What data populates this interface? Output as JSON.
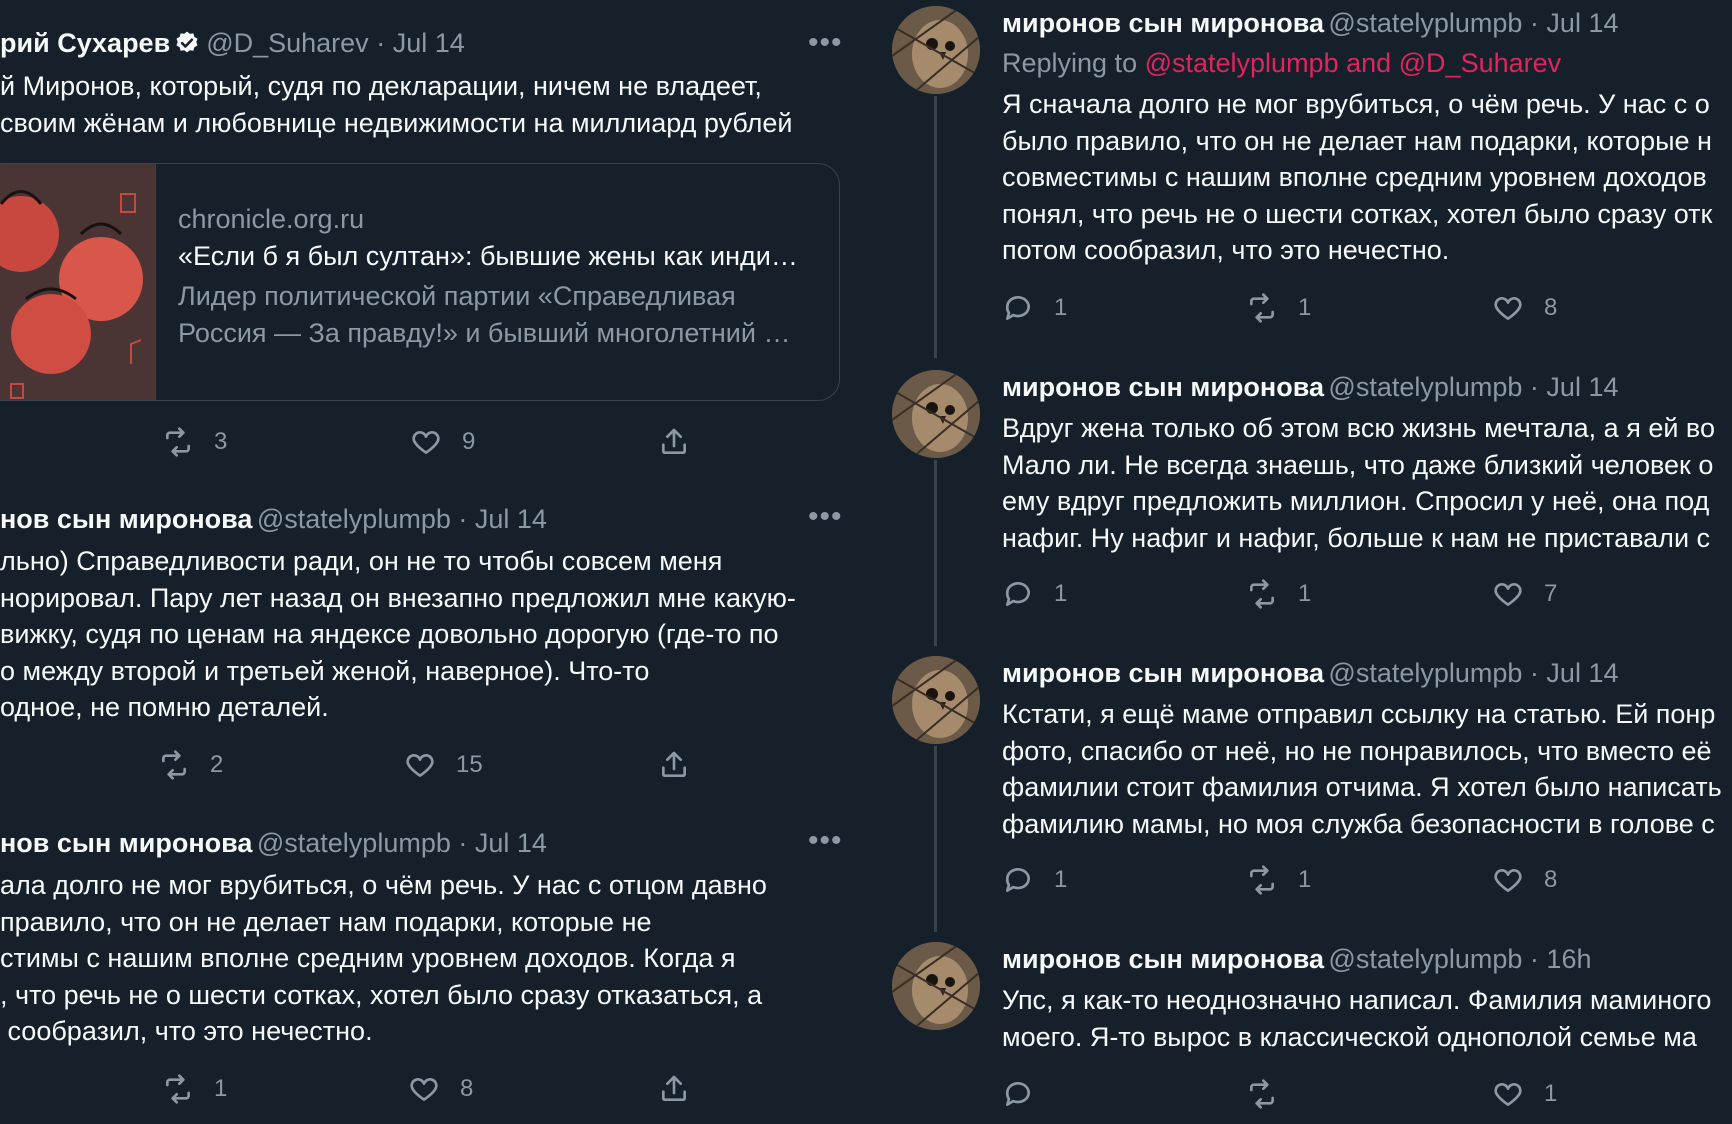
{
  "left_panel": {
    "tweets": [
      {
        "name": "рий Сухарев",
        "handle": "@D_Suharev",
        "date": "Jul 14",
        "text_lines": [
          "й Миронов, который, судя по декларации, ничем не владеет,",
          "своим жёнам и любовнице недвижимости на миллиард рублей"
        ],
        "card": {
          "domain": "chronicle.org.ru",
          "title": "«Если б я был султан»: бывшие жены как инди…",
          "desc_lines": [
            "Лидер политической партии «Справедливая",
            "Россия — За правду!» и бывший многолетний …"
          ]
        },
        "retweets": "3",
        "likes": "9"
      },
      {
        "name": "нов сын миронова",
        "handle": "@statelyplumpb",
        "date": "Jul 14",
        "text_lines": [
          "льно) Справедливости ради, он не то чтобы совсем меня",
          "норировал. Пару лет назад он внезапно предложил мне какую-",
          "вижку, судя по ценам на яндексе довольно дорогую (где-то по",
          "о между второй и третьей женой, наверное). Что-то",
          "одное, не помню деталей."
        ],
        "retweets": "2",
        "likes": "15"
      },
      {
        "name": "нов сын миронова",
        "handle": "@statelyplumpb",
        "date": "Jul 14",
        "text_lines": [
          "ала долго не мог врубиться, о чём речь. У нас с отцом давно",
          "правило, что он не делает нам подарки, которые не",
          "стимы с нашим вполне средним уровнем доходов. Когда я",
          ", что речь не о шести сотках, хотел было сразу отказаться, а",
          " сообразил, что это нечестно."
        ],
        "retweets": "1",
        "likes": "8"
      }
    ]
  },
  "right_panel": {
    "tweets": [
      {
        "name": "миронов сын миронова",
        "handle": "@statelyplumpb",
        "date": "Jul 14",
        "replying_prefix": "Replying to ",
        "replying_to": "@statelyplumpb and @D_Suharev",
        "text_lines": [
          "Я сначала долго не мог врубиться, о чём речь. У нас с о",
          "было правило, что он не делает нам подарки, которые н",
          "совместимы с нашим вполне средним уровнем доходов",
          "понял, что речь не о шести сотках, хотел было сразу отк",
          "потом сообразил, что это нечестно."
        ],
        "replies": "1",
        "retweets": "1",
        "likes": "8"
      },
      {
        "name": "миронов сын миронова",
        "handle": "@statelyplumpb",
        "date": "Jul 14",
        "text_lines": [
          "Вдруг жена только об этом всю жизнь мечтала, а я ей во",
          "Мало ли. Не всегда знаешь, что даже близкий человек о",
          "ему вдруг предложить миллион. Спросил у неё, она под",
          "нафиг. Ну нафиг и нафиг, больше к нам не приставали с"
        ],
        "replies": "1",
        "retweets": "1",
        "likes": "7"
      },
      {
        "name": "миронов сын миронова",
        "handle": "@statelyplumpb",
        "date": "Jul 14",
        "text_lines": [
          "Кстати, я ещё маме отправил ссылку на статью. Ей понр",
          "фото, спасибо от неё, но не понравилось, что вместо её",
          "фамилии стоит фамилия отчима. Я хотел было написать",
          "фамилию мамы, но моя служба безопасности в голове с"
        ],
        "replies": "1",
        "retweets": "1",
        "likes": "8"
      },
      {
        "name": "миронов сын миронова",
        "handle": "@statelyplumpb",
        "date": "16h",
        "text_lines": [
          "Упс, я как-то неоднозначно написал. Фамилия маминого",
          "моего. Я-то вырос в классической однополой семье ма"
        ],
        "likes": "1"
      }
    ]
  },
  "labels": {
    "more": "•••",
    "separator": " · "
  },
  "colors": {
    "background": "#15202b",
    "text": "#f7f9f9",
    "secondary": "#8b98a5",
    "link": "#e0245e",
    "border": "#38444d",
    "verified": "#f7f9f9"
  }
}
